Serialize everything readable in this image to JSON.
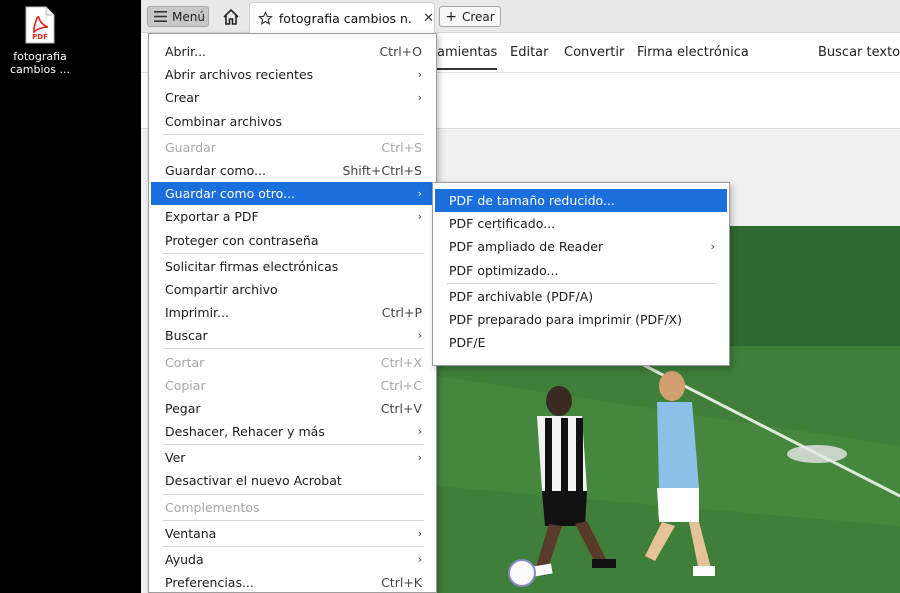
{
  "desktop": {
    "icon_badge": "PDF",
    "file_label": "fotografia cambios ..."
  },
  "app": {
    "menu_button": "Menú",
    "tab_title": "fotografia cambios n...",
    "create_button": "Crear",
    "toolbar": [
      {
        "label": "amientas"
      },
      {
        "label": "Editar"
      },
      {
        "label": "Convertir"
      },
      {
        "label": "Firma electrónica"
      },
      {
        "label": "Buscar texto o"
      }
    ]
  },
  "main_menu": {
    "items": [
      {
        "label": "Abrir...",
        "shortcut": "Ctrl+O"
      },
      {
        "label": "Abrir archivos recientes",
        "arrow": "›"
      },
      {
        "label": "Crear",
        "arrow": "›"
      },
      {
        "label": "Combinar archivos"
      },
      {
        "separator": true
      },
      {
        "label": "Guardar",
        "shortcut": "Ctrl+S",
        "disabled": true
      },
      {
        "label": "Guardar como...",
        "shortcut": "Shift+Ctrl+S"
      },
      {
        "label": "Guardar como otro...",
        "arrow": "›",
        "highlight": true
      },
      {
        "label": "Exportar a PDF",
        "arrow": "›"
      },
      {
        "label": "Proteger con contraseña"
      },
      {
        "separator": true
      },
      {
        "label": "Solicitar firmas electrónicas"
      },
      {
        "label": "Compartir archivo"
      },
      {
        "label": "Imprimir...",
        "shortcut": "Ctrl+P"
      },
      {
        "label": "Buscar",
        "arrow": "›"
      },
      {
        "separator": true
      },
      {
        "label": "Cortar",
        "shortcut": "Ctrl+X",
        "disabled": true
      },
      {
        "label": "Copiar",
        "shortcut": "Ctrl+C",
        "disabled": true
      },
      {
        "label": "Pegar",
        "shortcut": "Ctrl+V"
      },
      {
        "label": "Deshacer, Rehacer y más",
        "arrow": "›"
      },
      {
        "separator": true
      },
      {
        "label": "Ver",
        "arrow": "›"
      },
      {
        "label": "Desactivar el nuevo Acrobat"
      },
      {
        "separator": true
      },
      {
        "label": "Complementos",
        "disabled": true
      },
      {
        "separator": true
      },
      {
        "label": "Ventana",
        "arrow": "›"
      },
      {
        "separator": true
      },
      {
        "label": "Ayuda",
        "arrow": "›"
      },
      {
        "label": "Preferencias...",
        "shortcut": "Ctrl+K"
      }
    ]
  },
  "sub_menu": {
    "items": [
      {
        "label": "PDF de tamaño reducido...",
        "highlight": true
      },
      {
        "label": "PDF certificado..."
      },
      {
        "label": "PDF ampliado de Reader",
        "arrow": "›"
      },
      {
        "label": "PDF optimizado..."
      },
      {
        "separator": true
      },
      {
        "label": "PDF archivable (PDF/A)"
      },
      {
        "label": "PDF preparado para imprimir (PDF/X)"
      },
      {
        "label": "PDF/E"
      }
    ]
  },
  "colors": {
    "highlight": "#1a6fdc",
    "pitch_green": "#3f7f3a",
    "acrobat_red": "#e0251b"
  }
}
